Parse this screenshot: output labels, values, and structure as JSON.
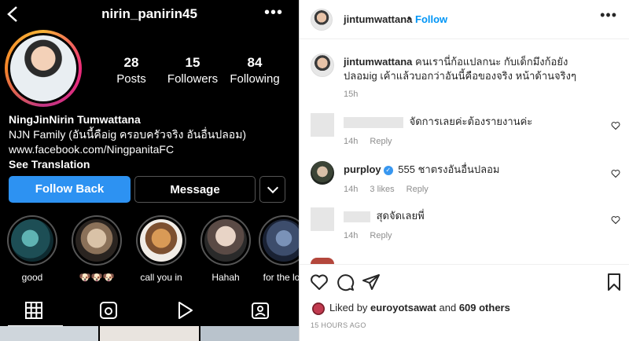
{
  "profile": {
    "username": "nirin_panirin45",
    "stats": [
      {
        "num": "28",
        "label": "Posts"
      },
      {
        "num": "15",
        "label": "Followers"
      },
      {
        "num": "84",
        "label": "Following"
      }
    ],
    "name": "NingJinNirin Tumwattana",
    "bio_line": "NJN Family (อันนี้คือig ครอบครัวจริง อันอื่นปลอม)",
    "link": "www.facebook.com/NingpanitaFC",
    "see_translation": "See Translation",
    "follow_label": "Follow Back",
    "message_label": "Message",
    "highlights": [
      {
        "caption": "good"
      },
      {
        "caption": "🐶🐶🐶"
      },
      {
        "caption": "call you in"
      },
      {
        "caption": "Hahah"
      },
      {
        "caption": "for the lov"
      }
    ],
    "tabs": [
      "grid-icon",
      "reels-icon",
      "play-icon",
      "tagged-icon"
    ]
  },
  "post": {
    "owner": "jintumwattana",
    "dot": "•",
    "follow_label": "Follow",
    "caption_user": "jintumwattana",
    "caption_text": "คนเรานี่ก้อแปลกนะ กับเด็กมึงก้อยังปลอมig เค้าแล้วบอกว่าอันนี้คือของจริง หน้าด้านจริงๆ",
    "caption_time": "15h",
    "comments": [
      {
        "text": "จัดการเลยค่ะต้องรายงานค่ะ",
        "time": "14h",
        "reply": "Reply"
      },
      {
        "user": "purploy",
        "text": "555 ชาตรงอันอื่นปลอม",
        "time": "14h",
        "likes": "3 likes",
        "reply": "Reply"
      },
      {
        "text": "สุดจัดเลยพี่",
        "time": "14h",
        "reply": "Reply"
      }
    ],
    "liked_prefix": "Liked by",
    "liked_user": "euroyotsawat",
    "liked_and": "and",
    "liked_others": "609 others",
    "ago": "15 HOURS AGO"
  },
  "colors": {
    "follow_blue": "#0095f6",
    "button_blue": "#2d92f2",
    "verified": "#3897f0"
  }
}
